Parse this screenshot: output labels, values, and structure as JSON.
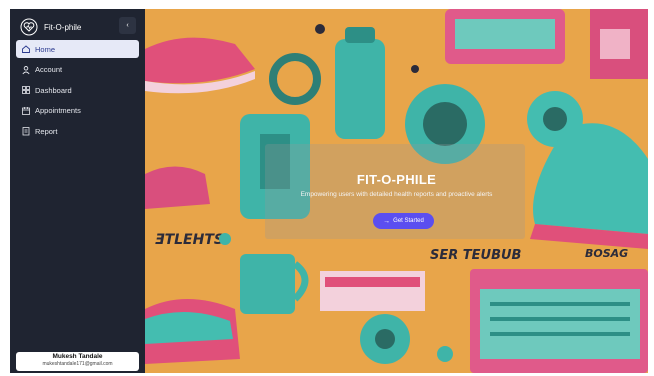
{
  "app": {
    "name": "Fit-O-phile"
  },
  "sidebar": {
    "collapse_glyph": "‹",
    "items": [
      {
        "label": "Home",
        "icon": "home-icon",
        "active": true
      },
      {
        "label": "Account",
        "icon": "user-icon",
        "active": false
      },
      {
        "label": "Dashboard",
        "icon": "dashboard-icon",
        "active": false
      },
      {
        "label": "Appointments",
        "icon": "appointments-icon",
        "active": false
      },
      {
        "label": "Report",
        "icon": "report-icon",
        "active": false
      }
    ],
    "user": {
      "name": "Mukesh Tandale",
      "email": "mukeshtandale171@gmail.com"
    }
  },
  "hero": {
    "title": "FIT-O-PHILE",
    "subtitle": "Empowering users with detailed health reports and proactive alerts",
    "cta_label": "Get Started",
    "cta_glyph": "→"
  },
  "colors": {
    "sidebar_bg": "#1f2431",
    "active_item_bg": "#e6e9f7",
    "cta_bg": "#5b4ef0",
    "hero_bg": "#e8a54a"
  }
}
